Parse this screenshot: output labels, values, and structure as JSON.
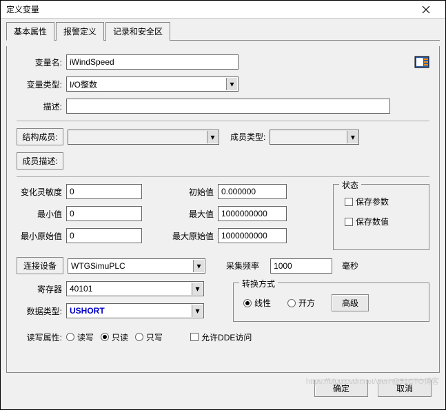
{
  "window": {
    "title": "定义变量"
  },
  "tabs": {
    "t0": "基本属性",
    "t1": "报警定义",
    "t2": "记录和安全区"
  },
  "labels": {
    "varName": "变量名:",
    "varType": "变量类型:",
    "desc": "描述:",
    "structMember": "结构成员:",
    "memberType": "成员类型:",
    "memberDesc": "成员描述:",
    "sensitivity": "变化灵敏度",
    "initVal": "初始值",
    "minVal": "最小值",
    "maxVal": "最大值",
    "minRaw": "最小原始值",
    "maxRaw": "最大原始值",
    "connDevice": "连接设备",
    "sampleRate": "采集频率",
    "ms": "毫秒",
    "register": "寄存器",
    "convMethod": "转换方式",
    "dataType": "数据类型:",
    "linear": "线性",
    "sqrt": "开方",
    "advanced": "高级",
    "rwAttr": "读写属性:",
    "rw": "读写",
    "ro": "只读",
    "wo": "只写",
    "allowDDE": "允许DDE访问",
    "status": "状态",
    "saveParam": "保存参数",
    "saveValue": "保存数值",
    "ok": "确定",
    "cancel": "取消"
  },
  "values": {
    "varName": "iWindSpeed",
    "varType": "I/O整数",
    "desc": "",
    "sensitivity": "0",
    "initVal": "0.000000",
    "minVal": "0",
    "maxVal": "1000000000",
    "minRaw": "0",
    "maxRaw": "1000000000",
    "connDevice": "WTGSimuPLC",
    "sampleRate": "1000",
    "register": "40101",
    "dataType": "USHORT"
  },
  "watermark": "https://blog.csdn.net/wen @51CTO博客"
}
